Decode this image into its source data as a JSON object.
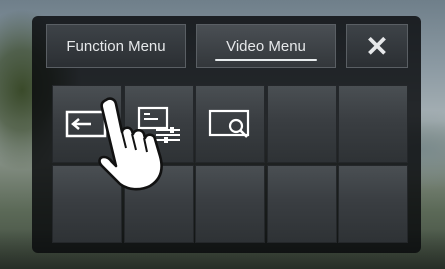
{
  "tabs": {
    "function_menu": "Function Menu",
    "video_menu": "Video Menu",
    "close_glyph": "✕"
  },
  "grid": {
    "rows": 2,
    "columns": 5,
    "icons": [
      "back-arrow-icon",
      "subtitle-settings-icon",
      "zoom-icon",
      "",
      "",
      "",
      "",
      "",
      "",
      ""
    ]
  },
  "colors": {
    "panel": "#2b2f33",
    "tab_highlight": "#e8ecee",
    "icon": "#ffffff"
  }
}
